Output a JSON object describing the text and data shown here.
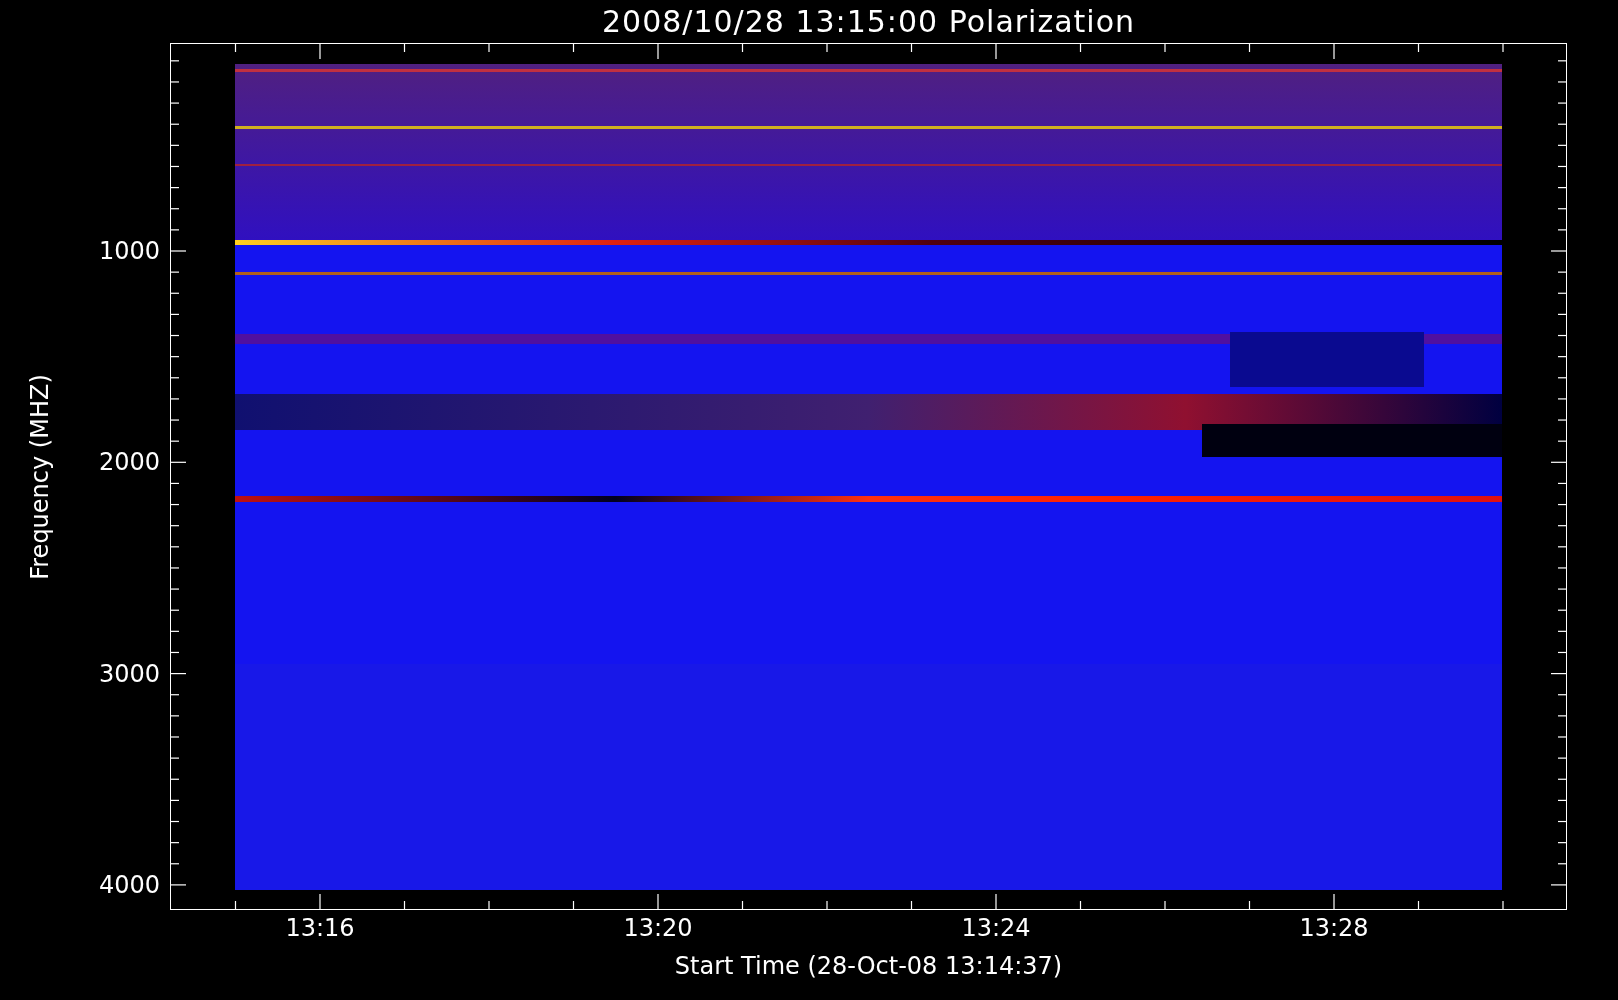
{
  "title": "2008/10/28 13:15:00 Polarization",
  "y_axis": {
    "label": "Frequency (MHZ)",
    "ticks": [
      "1000",
      "2000",
      "3000",
      "4000"
    ]
  },
  "x_axis": {
    "label": "Start Time (28-Oct-08 13:14:37)",
    "ticks": [
      "13:16",
      "13:20",
      "13:24",
      "13:28"
    ]
  }
}
